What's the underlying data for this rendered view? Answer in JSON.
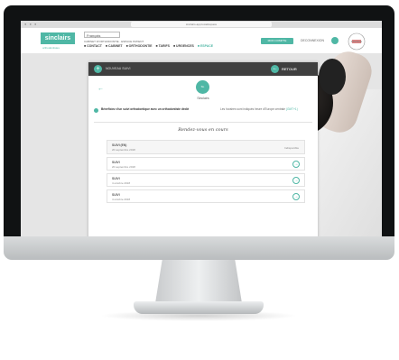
{
  "browser": {
    "url": "sinclairs-app.local/espace",
    "window_dots": "● ● ●"
  },
  "header": {
    "logo_text": "sinclairs",
    "logo_subtitle": "orthodontistes",
    "language_select": "Français",
    "tagline": "CABINET D'ORTHODONTIE · ESPACE PATIENT",
    "nav": [
      {
        "label": "■ CONTACT"
      },
      {
        "label": "■ CABINET"
      },
      {
        "label": "■ ORTHODONTIE"
      },
      {
        "label": "■ TARIFS"
      },
      {
        "label": "■ URGENCES"
      },
      {
        "label": "■ ESPACE"
      }
    ],
    "cta_button": "MON COMPTE",
    "account_text": "DECONNEXION",
    "stamp_text": "FRANCE"
  },
  "card": {
    "header_left_label": "NOUVEAU SUIVI",
    "header_back_label": "RETOUR",
    "plus_icon_glyph": "+",
    "back_icon_glyph": "←",
    "back_arrow_glyph": "←",
    "avatar_text": "SL",
    "patient_name": "Sinclairs",
    "info_text": "Bénéficiez d'un suivi orthodontique avec un orthodontiste dédié",
    "info_right_text": "Les horaires sont indiqués heure d'Europe centrale",
    "info_right_link": "(GMT+1)",
    "section_title": "Rendez-vous en cours",
    "rows": [
      {
        "title": "SUIVI (EN)",
        "date": "20 septembre 2018",
        "status": "Indisponible",
        "button": ""
      },
      {
        "title": "SUIVI",
        "date": "20 septembre 2018",
        "status": "",
        "button": "→"
      },
      {
        "title": "SUIVI",
        "date": "4 octobre 2018",
        "status": "",
        "button": "→"
      },
      {
        "title": "SUIVI",
        "date": "4 octobre 2018",
        "status": "",
        "button": "→"
      }
    ]
  },
  "colors": {
    "accent": "#4fb7a5",
    "card_header": "#3f3f3f",
    "bezel": "#101213"
  }
}
